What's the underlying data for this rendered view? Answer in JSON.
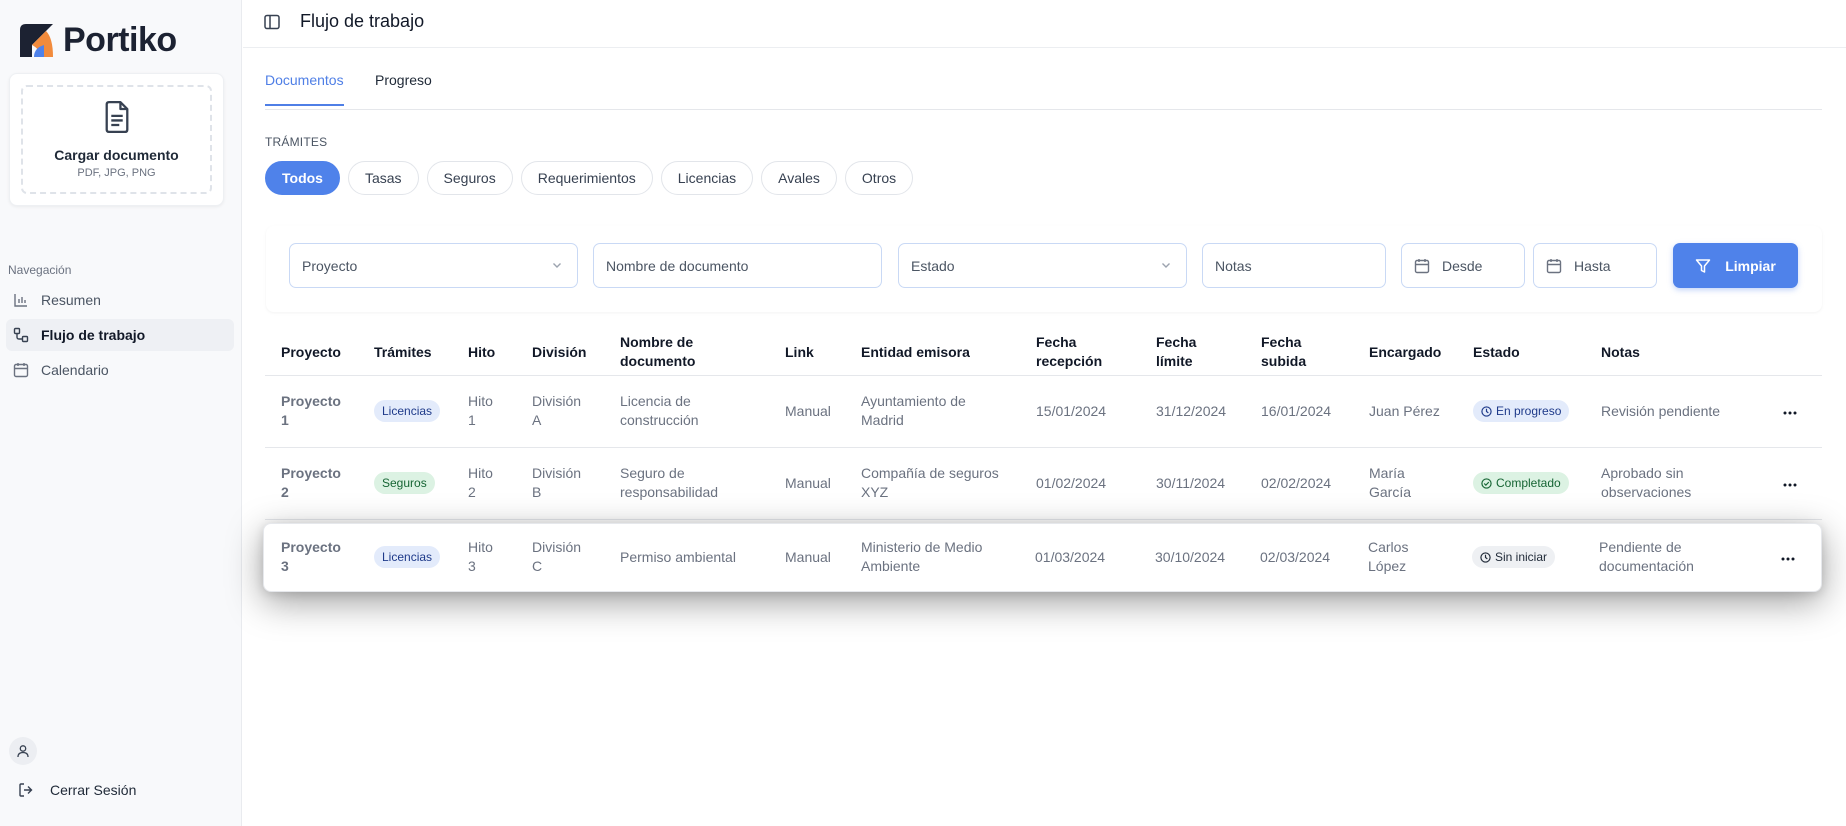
{
  "app": {
    "name": "Portiko"
  },
  "sidebar": {
    "upload": {
      "title": "Cargar documento",
      "formats": "PDF, JPG, PNG"
    },
    "nav_label": "Navegación",
    "items": [
      {
        "label": "Resumen",
        "icon": "bar-chart-icon"
      },
      {
        "label": "Flujo de trabajo",
        "icon": "workflow-icon",
        "active": true
      },
      {
        "label": "Calendario",
        "icon": "calendar-icon"
      }
    ],
    "logout_label": "Cerrar Sesión"
  },
  "header": {
    "title": "Flujo de trabajo"
  },
  "tabs": [
    {
      "label": "Documentos",
      "active": true
    },
    {
      "label": "Progreso"
    }
  ],
  "tramites": {
    "label": "TRÁMITES",
    "chips": [
      "Todos",
      "Tasas",
      "Seguros",
      "Requerimientos",
      "Licencias",
      "Avales",
      "Otros"
    ]
  },
  "filters": {
    "proyecto": "Proyecto",
    "nombre": "Nombre de documento",
    "estado": "Estado",
    "notas": "Notas",
    "desde": "Desde",
    "hasta": "Hasta",
    "clear_label": "Limpiar"
  },
  "table": {
    "headers": {
      "proyecto": "Proyecto",
      "tramites": "Trámites",
      "hito": "Hito",
      "division": "División",
      "nombre_1": "Nombre de",
      "nombre_2": "documento",
      "link": "Link",
      "entidad": "Entidad emisora",
      "recepcion_1": "Fecha",
      "recepcion_2": "recepción",
      "limite_1": "Fecha",
      "limite_2": "límite",
      "subida_1": "Fecha",
      "subida_2": "subida",
      "encargado": "Encargado",
      "estado": "Estado",
      "notas": "Notas"
    },
    "rows": [
      {
        "proyecto": [
          "Proyecto",
          "1"
        ],
        "tramite": "Licencias",
        "hito": [
          "Hito",
          "1"
        ],
        "division": [
          "División",
          "A"
        ],
        "nombre": [
          "Licencia de",
          "construcción"
        ],
        "link": "Manual",
        "entidad": [
          "Ayuntamiento de",
          "Madrid"
        ],
        "recepcion": "15/01/2024",
        "limite": "31/12/2024",
        "subida": "16/01/2024",
        "encargado": [
          "Juan Pérez",
          ""
        ],
        "estado": "En progreso",
        "notas": [
          "Revisión pendiente",
          ""
        ]
      },
      {
        "proyecto": [
          "Proyecto",
          "2"
        ],
        "tramite": "Seguros",
        "hito": [
          "Hito",
          "2"
        ],
        "division": [
          "División",
          "B"
        ],
        "nombre": [
          "Seguro de",
          "responsabilidad"
        ],
        "link": "Manual",
        "entidad": [
          "Compañía de seguros",
          "XYZ"
        ],
        "recepcion": "01/02/2024",
        "limite": "30/11/2024",
        "subida": "02/02/2024",
        "encargado": [
          "María",
          "García"
        ],
        "estado": "Completado",
        "notas": [
          "Aprobado sin",
          "observaciones"
        ]
      },
      {
        "proyecto": [
          "Proyecto",
          "3"
        ],
        "tramite": "Licencias",
        "hito": [
          "Hito",
          "3"
        ],
        "division": [
          "División",
          "C"
        ],
        "nombre": [
          "Permiso ambiental",
          ""
        ],
        "link": "Manual",
        "entidad": [
          "Ministerio de Medio",
          "Ambiente"
        ],
        "recepcion": "01/03/2024",
        "limite": "30/10/2024",
        "subida": "02/03/2024",
        "encargado": [
          "Carlos",
          "López"
        ],
        "estado": "Sin iniciar",
        "notas": [
          "Pendiente de",
          "documentación"
        ]
      }
    ]
  },
  "colors": {
    "accent": "#4f82ea",
    "logo_dark": "#1c2232",
    "logo_orange": "#f28b3c",
    "logo_blue": "#4f82ea"
  }
}
